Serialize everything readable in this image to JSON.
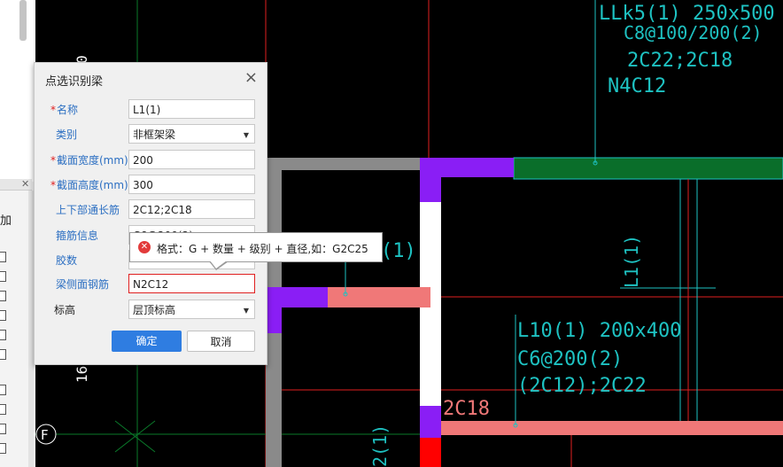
{
  "dialog": {
    "title": "点选识别梁",
    "fields": [
      {
        "label": "名称",
        "required": true,
        "value": "L1(1)",
        "type": "text"
      },
      {
        "label": "类别",
        "required": false,
        "value": "非框架梁",
        "type": "select"
      },
      {
        "label": "截面宽度(mm)",
        "required": true,
        "value": "200",
        "type": "text"
      },
      {
        "label": "截面高度(mm)",
        "required": true,
        "value": "300",
        "type": "text"
      },
      {
        "label": "上下部通长筋",
        "required": false,
        "value": "2C12;2C18",
        "type": "text"
      },
      {
        "label": "箍筋信息",
        "required": false,
        "value": "C6@200(2)",
        "type": "text"
      },
      {
        "label": "胶数",
        "required": false,
        "value": "",
        "type": "text"
      },
      {
        "label": "梁侧面钢筋",
        "required": false,
        "value": "N2C12",
        "type": "text",
        "error": true
      },
      {
        "label": "标高",
        "required": false,
        "value": "层顶标高",
        "type": "select"
      }
    ],
    "ok_label": "确定",
    "cancel_label": "取消"
  },
  "tooltip": {
    "message": "格式：G + 数量 + 级别 + 直径,如：G2C25"
  },
  "left_panel": {
    "add_label": "加"
  },
  "cad": {
    "labels": [
      {
        "text": "LLk5(1) 250x500"
      },
      {
        "text": "C8@100/200(2)"
      },
      {
        "text": "2C22;2C18"
      },
      {
        "text": "N4C12"
      },
      {
        "text": "L10(1) 200x400"
      },
      {
        "text": "C6@200(2)"
      },
      {
        "text": "(2C12);2C22"
      },
      {
        "text": "2C18"
      },
      {
        "text": "L1(1)"
      },
      {
        "text": "(1)"
      },
      {
        "text": "2(1)"
      },
      {
        "text": "16"
      },
      {
        "text": "0"
      },
      {
        "text": "F"
      }
    ],
    "colors": {
      "beam_pink": "#f07878",
      "column_purple": "#8a1ef5",
      "beam_green": "#0a6e2a",
      "text_cyan": "#1ec2c2",
      "axis_red": "#e02020"
    }
  }
}
